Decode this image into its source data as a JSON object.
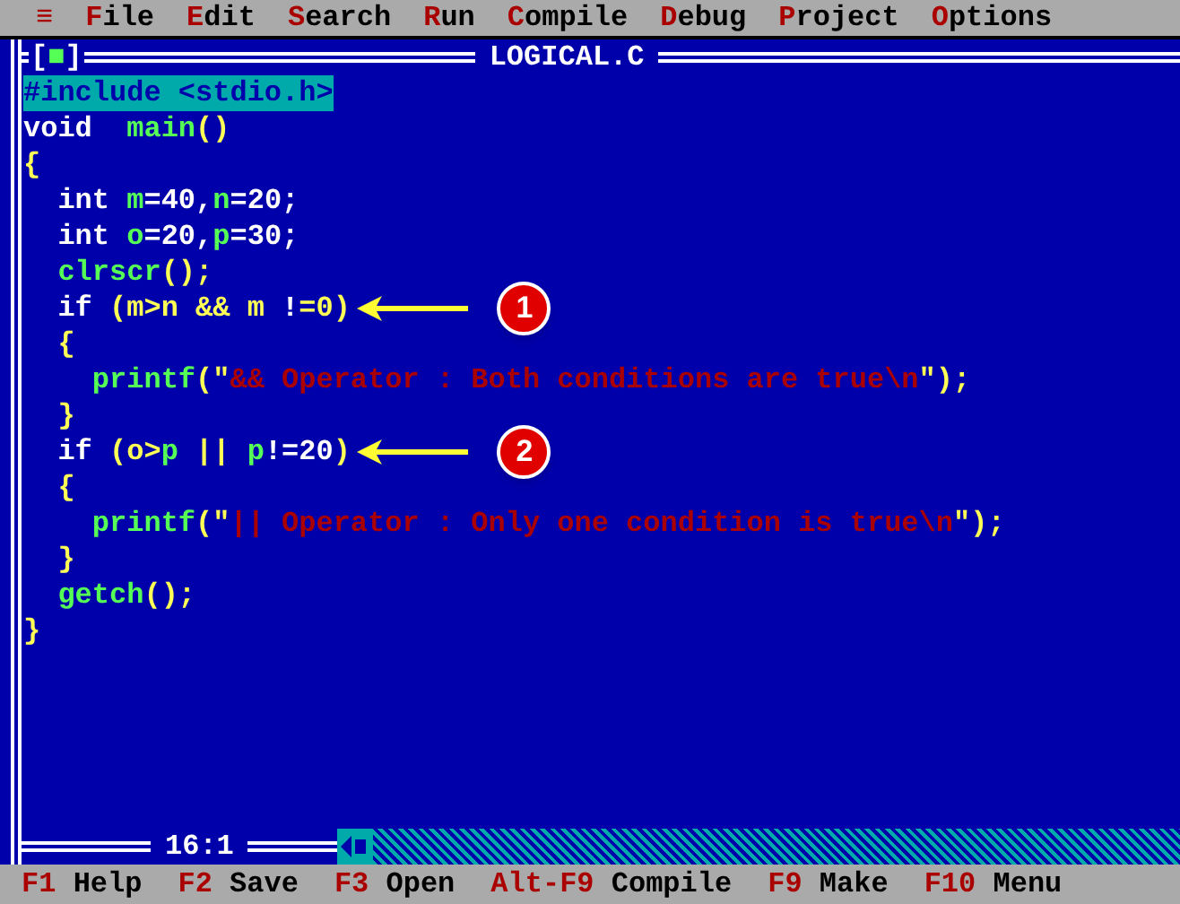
{
  "menu_bar": {
    "system_icon": "≡",
    "items": [
      {
        "label": "File"
      },
      {
        "label": "Edit"
      },
      {
        "label": "Search"
      },
      {
        "label": "Run"
      },
      {
        "label": "Compile"
      },
      {
        "label": "Debug"
      },
      {
        "label": "Project"
      },
      {
        "label": "Options"
      }
    ]
  },
  "editor": {
    "title": "LOGICAL.C",
    "close_box": "[■]",
    "lines": [
      {
        "highlighted": true,
        "tokens": [
          {
            "kind": "plain",
            "text": "#include <stdio.h>"
          }
        ]
      },
      {
        "highlighted": false,
        "tokens": [
          {
            "kind": "plain",
            "text": "void  "
          },
          {
            "kind": "ident",
            "text": "main"
          },
          {
            "kind": "punct",
            "text": "()"
          }
        ]
      },
      {
        "highlighted": false,
        "tokens": [
          {
            "kind": "punct",
            "text": "{"
          }
        ]
      },
      {
        "highlighted": false,
        "tokens": [
          {
            "kind": "plain",
            "text": "  int "
          },
          {
            "kind": "ident",
            "text": "m"
          },
          {
            "kind": "plain",
            "text": "=40,"
          },
          {
            "kind": "ident",
            "text": "n"
          },
          {
            "kind": "plain",
            "text": "=20;"
          }
        ]
      },
      {
        "highlighted": false,
        "tokens": [
          {
            "kind": "plain",
            "text": "  int "
          },
          {
            "kind": "ident",
            "text": "o"
          },
          {
            "kind": "plain",
            "text": "=20,"
          },
          {
            "kind": "ident",
            "text": "p"
          },
          {
            "kind": "plain",
            "text": "=30;"
          }
        ]
      },
      {
        "highlighted": false,
        "tokens": [
          {
            "kind": "ident",
            "text": "  clrscr"
          },
          {
            "kind": "punct",
            "text": "();"
          }
        ]
      },
      {
        "highlighted": false,
        "callout": "1",
        "tokens": [
          {
            "kind": "plain",
            "text": "  if "
          },
          {
            "kind": "punct",
            "text": "(m>n && m "
          },
          {
            "kind": "plain",
            "text": "!"
          },
          {
            "kind": "punct",
            "text": "=0)"
          }
        ]
      },
      {
        "highlighted": false,
        "tokens": [
          {
            "kind": "punct",
            "text": "  {"
          }
        ]
      },
      {
        "highlighted": false,
        "tokens": [
          {
            "kind": "ident",
            "text": "    printf"
          },
          {
            "kind": "punct",
            "text": "(\""
          },
          {
            "kind": "string",
            "text": "&& Operator : Both conditions are true\\n"
          },
          {
            "kind": "punct",
            "text": "\");"
          }
        ]
      },
      {
        "highlighted": false,
        "tokens": [
          {
            "kind": "punct",
            "text": "  }"
          }
        ]
      },
      {
        "highlighted": false,
        "callout": "2",
        "tokens": [
          {
            "kind": "plain",
            "text": "  if "
          },
          {
            "kind": "punct",
            "text": "(o>"
          },
          {
            "kind": "ident",
            "text": "p"
          },
          {
            "kind": "punct",
            "text": " || "
          },
          {
            "kind": "ident",
            "text": "p"
          },
          {
            "kind": "plain",
            "text": "!=20"
          },
          {
            "kind": "punct",
            "text": ")"
          }
        ]
      },
      {
        "highlighted": false,
        "tokens": [
          {
            "kind": "punct",
            "text": "  {"
          }
        ]
      },
      {
        "highlighted": false,
        "tokens": [
          {
            "kind": "ident",
            "text": "    printf"
          },
          {
            "kind": "punct",
            "text": "(\""
          },
          {
            "kind": "string",
            "text": "|| Operator : Only one condition is true\\n"
          },
          {
            "kind": "punct",
            "text": "\");"
          }
        ]
      },
      {
        "highlighted": false,
        "tokens": [
          {
            "kind": "punct",
            "text": "  }"
          }
        ]
      },
      {
        "highlighted": false,
        "tokens": [
          {
            "kind": "ident",
            "text": "  getch"
          },
          {
            "kind": "punct",
            "text": "();"
          }
        ]
      },
      {
        "highlighted": false,
        "tokens": [
          {
            "kind": "punct",
            "text": "}"
          }
        ]
      }
    ],
    "cursor_position": "16:1"
  },
  "status_bar": [
    {
      "key": "F1",
      "label": "Help"
    },
    {
      "key": "F2",
      "label": "Save"
    },
    {
      "key": "F3",
      "label": "Open"
    },
    {
      "key": "Alt-F9",
      "label": "Compile"
    },
    {
      "key": "F9",
      "label": "Make"
    },
    {
      "key": "F10",
      "label": "Menu"
    }
  ]
}
